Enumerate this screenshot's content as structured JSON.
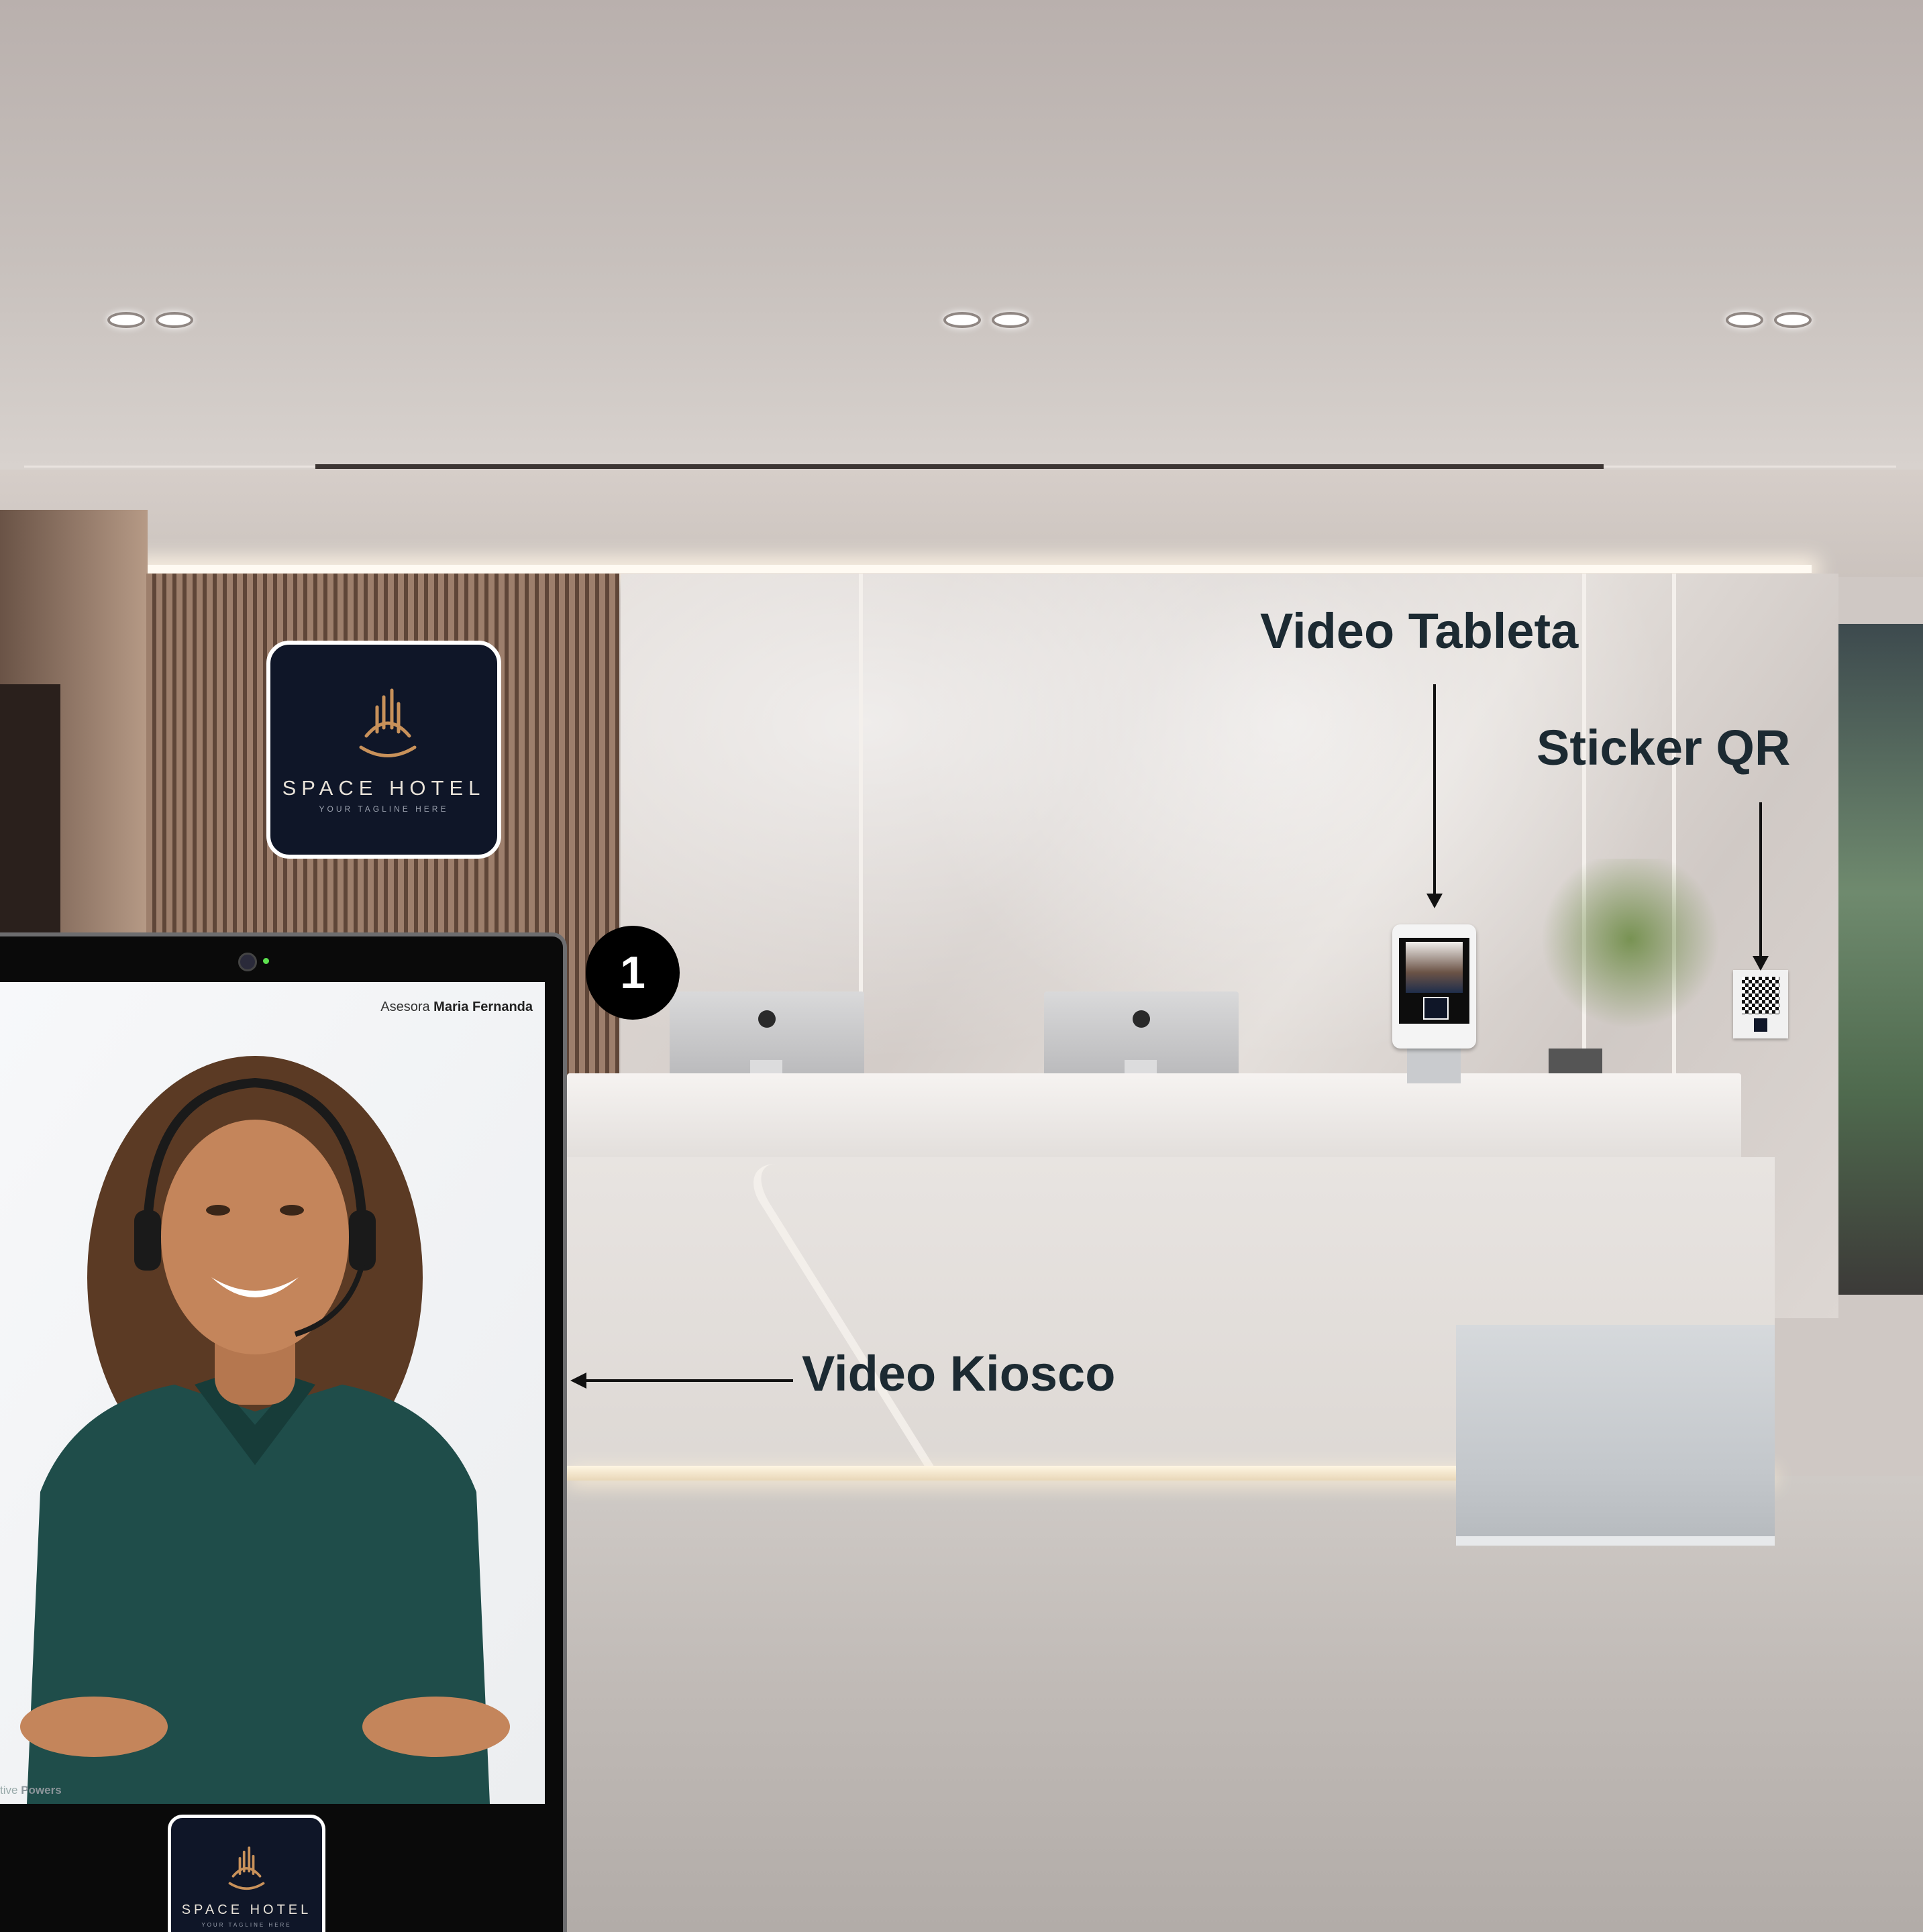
{
  "annotations": {
    "video_tableta": "Video Tableta",
    "sticker_qr": "Sticker QR",
    "video_kiosco": "Video Kiosco",
    "step_badge": "1"
  },
  "wall_logo": {
    "name": "SPACE HOTEL",
    "tagline": "YOUR TAGLINE HERE"
  },
  "kiosk": {
    "advisor_prefix": "Asesora",
    "advisor_name": "Maria Fernanda",
    "footer_prefix": "tive",
    "footer_brand": "Powers",
    "logo_name": "SPACE HOTEL",
    "logo_tagline": "YOUR TAGLINE HERE"
  },
  "colors": {
    "logo_background": "#0f1628",
    "logo_accent": "#c8915a",
    "annotation_text": "#1c2a32",
    "badge_background": "#000000"
  },
  "icons": [
    "apple-logo-icon",
    "hotel-logo-icon",
    "qr-code-icon",
    "camera-icon"
  ]
}
